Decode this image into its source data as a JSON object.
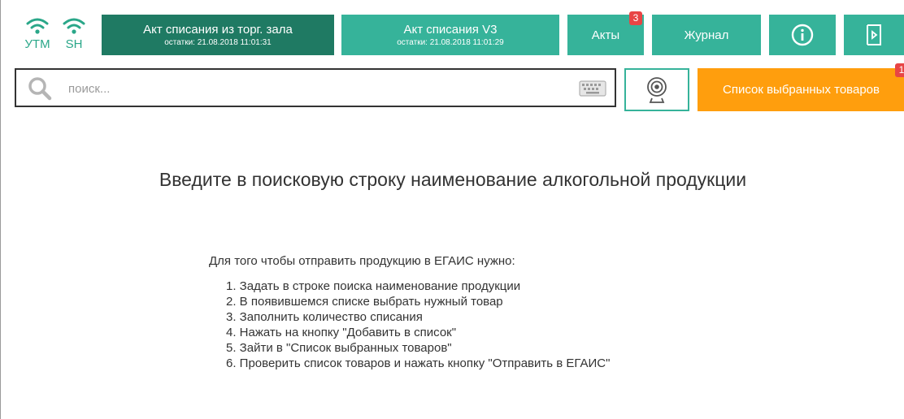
{
  "status": {
    "utm_label": "УТМ",
    "sh_label": "SH",
    "color": "#2aa789"
  },
  "nav": {
    "act_hall": {
      "title": "Акт списания из торг. зала",
      "subtitle": "остатки: 21.08.2018 11:01:31"
    },
    "act_v3": {
      "title": "Акт списания V3",
      "subtitle": "остатки: 21.08.2018 11:01:29"
    },
    "acts": {
      "label": "Акты",
      "badge": "3"
    },
    "journal": {
      "label": "Журнал"
    },
    "info_icon": "info-icon",
    "exit_icon": "exit-icon"
  },
  "search": {
    "placeholder": "поиск...",
    "value": ""
  },
  "selected_list": {
    "label": "Список выбранных товаров",
    "badge": "1"
  },
  "main": {
    "headline": "Введите в поисковую строку наименование алкогольной продукции",
    "intro": "Для того чтобы отправить продукцию в ЕГАИС нужно:",
    "steps": [
      "1. Задать в строке поиска наименование продукции",
      "2. В появившемся списке выбрать нужный товар",
      "3. Заполнить количество списания",
      "4. Нажать на кнопку \"Добавить в список\"",
      "5. Зайти в \"Список выбранных товаров\"",
      "6. Проверить список товаров и нажать кнопку \"Отправить в ЕГАИС\""
    ]
  },
  "colors": {
    "dark_green": "#1f7a63",
    "teal": "#36b39a",
    "orange": "#ff9e0d",
    "badge_red": "#e84545"
  }
}
